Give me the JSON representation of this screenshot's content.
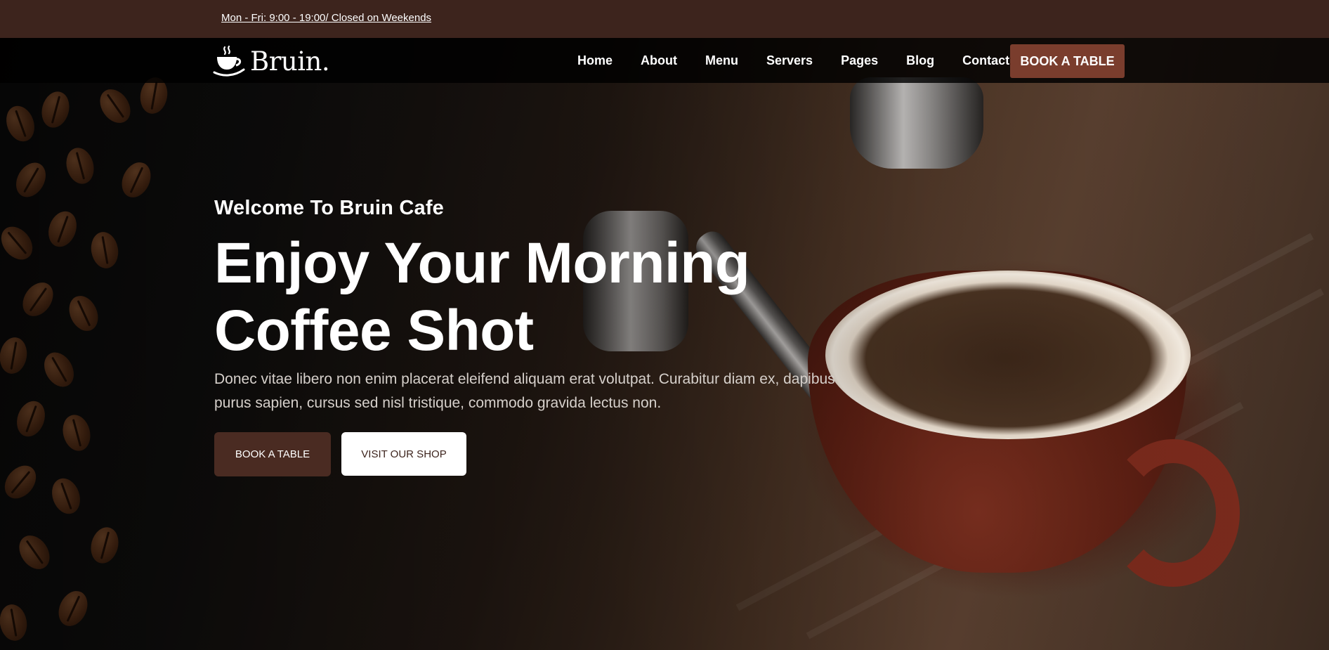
{
  "top_bar": {
    "hours": "Mon - Fri: 9:00 - 19:00/ Closed on Weekends"
  },
  "nav": {
    "logo_text": "Bruin.",
    "logo_icon": "coffee-cup-icon",
    "links": [
      "Home",
      "About",
      "Menu",
      "Servers",
      "Pages",
      "Blog",
      "Contact"
    ],
    "cta_label": "BOOK A TABLE"
  },
  "hero": {
    "eyebrow": "Welcome To Bruin Cafe",
    "headline_line1": "Enjoy Your Morning",
    "headline_line2": "Coffee Shot",
    "description": "Donec vitae libero non enim placerat eleifend aliquam erat volutpat. Curabitur diam ex, dapibus purus sapien, cursus sed nisl tristique, commodo gravida lectus non.",
    "primary_button": "BOOK A TABLE",
    "secondary_button": "VISIT OUR SHOP"
  },
  "colors": {
    "top_bar": "#3d241d",
    "accent": "#7a3d2d",
    "primary_button": "#4a2b22"
  }
}
